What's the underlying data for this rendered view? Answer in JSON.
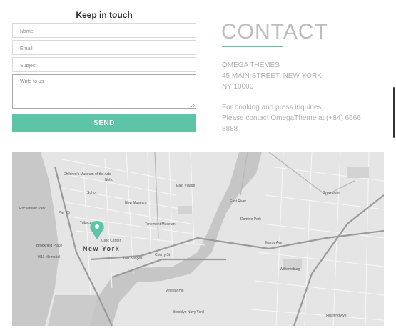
{
  "form": {
    "title": "Keep in touch",
    "name_placeholder": "Name",
    "email_placeholder": "Email",
    "subject_placeholder": "Subject",
    "message_placeholder": "Write to us",
    "send_label": "SEND"
  },
  "contact": {
    "title": "CONTACT",
    "company": "OMEGA THEMES",
    "address_line1": "45 MAIN STREET, NEW YORK,",
    "address_line2": "NY 10000",
    "booking_line1": "For booking and press inquiries,",
    "booking_line2": "Please contact OmegaTheme at (+84) 6666",
    "booking_line3": "8888"
  },
  "map": {
    "city_label": "New York",
    "labels": [
      "Children's Museum of the Arts",
      "Rockefeller Park",
      "Pier 25",
      "Brookfield Place",
      "9/11 Memorial",
      "Civic Center",
      "Two Bridges",
      "New Museum",
      "Tenement Museum",
      "East Village",
      "Noho",
      "Soho",
      "Tribeca",
      "East River",
      "Williamsburg",
      "Greenpoint",
      "Marcy Ave",
      "Brooklyn Navy Yard",
      "Vinegar Hill",
      "Cherry St",
      "Flushing Ave",
      "Domino Park"
    ],
    "marker_color": "#5ec4a7"
  },
  "colors": {
    "accent": "#5ec4a7",
    "muted_text": "#b0b0b0"
  }
}
